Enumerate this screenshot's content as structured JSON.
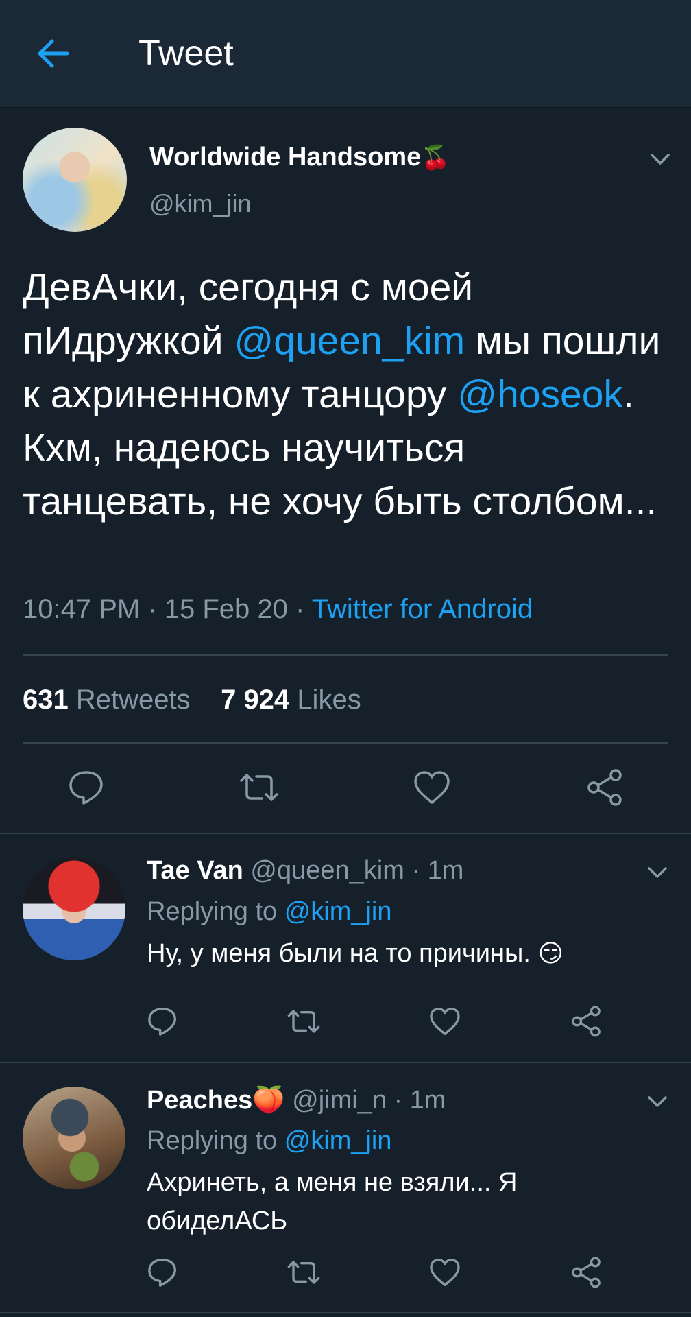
{
  "header": {
    "title": "Tweet"
  },
  "tweet": {
    "author_name": "Worldwide Handsome",
    "author_emoji": "🍒",
    "author_handle": "@kim_jin",
    "text_parts": {
      "p1": "ДевАчки, сегодня с моей пИдружкой ",
      "m1": "@queen_kim",
      "p2": " мы пошли к ахриненному танцору ",
      "m2": "@hoseok",
      "p3": ". Кхм, надеюсь научиться танцевать, не хочу быть столбом..."
    },
    "time": "10:47 PM",
    "date": "15 Feb 20",
    "source": "Twitter for Android",
    "retweets_count": "631",
    "retweets_label": "Retweets",
    "likes_count": "7 924",
    "likes_label": "Likes"
  },
  "replies": [
    {
      "name": "Tae Van",
      "handle": "@queen_kim",
      "time": "1m",
      "replying_prefix": "Replying to",
      "replying_to": "@kim_jin",
      "text": "Ну, у меня были на то причины.",
      "emoji": "😏"
    },
    {
      "name": "Peaches",
      "name_emoji": "🍑",
      "handle": "@jimi_n",
      "time": "1m",
      "replying_prefix": "Replying to",
      "replying_to": "@kim_jin",
      "text": "Ахринеть, а меня не взяли... Я обиделАСЬ"
    }
  ],
  "icons": [
    "back-arrow-icon",
    "chevron-down-icon",
    "reply-icon",
    "retweet-icon",
    "like-icon",
    "share-icon"
  ],
  "colors": {
    "background": "#15202b",
    "header": "#1b2836",
    "accent": "#1da1f2",
    "secondary_text": "#8899a6",
    "divider": "#38444d"
  }
}
